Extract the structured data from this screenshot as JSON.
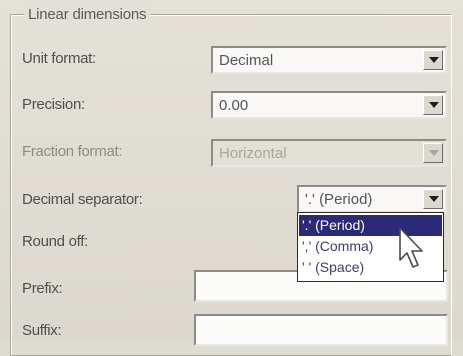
{
  "group": {
    "title": "Linear dimensions"
  },
  "rows": {
    "unit_format": {
      "label": "Unit format:",
      "value": "Decimal"
    },
    "precision": {
      "label": "Precision:",
      "value": "0.00"
    },
    "fraction_format": {
      "label": "Fraction format:",
      "value": "Horizontal"
    },
    "decimal_separator": {
      "label": "Decimal separator:",
      "value": "'.' (Period)"
    },
    "round_off": {
      "label": "Round off:"
    },
    "prefix": {
      "label": "Prefix:"
    },
    "suffix": {
      "label": "Suffix:"
    }
  },
  "dropdown": {
    "options": [
      {
        "label": "'.' (Period)",
        "selected": true
      },
      {
        "label": "',' (Comma)",
        "selected": false
      },
      {
        "label": "' ' (Space)",
        "selected": false
      }
    ]
  },
  "colors": {
    "selection": "#2a2a78",
    "panel": "#dedbd3"
  },
  "icons": {
    "cursor": "mouse-pointer-icon",
    "dropdown_arrow": "chevron-down-icon"
  }
}
